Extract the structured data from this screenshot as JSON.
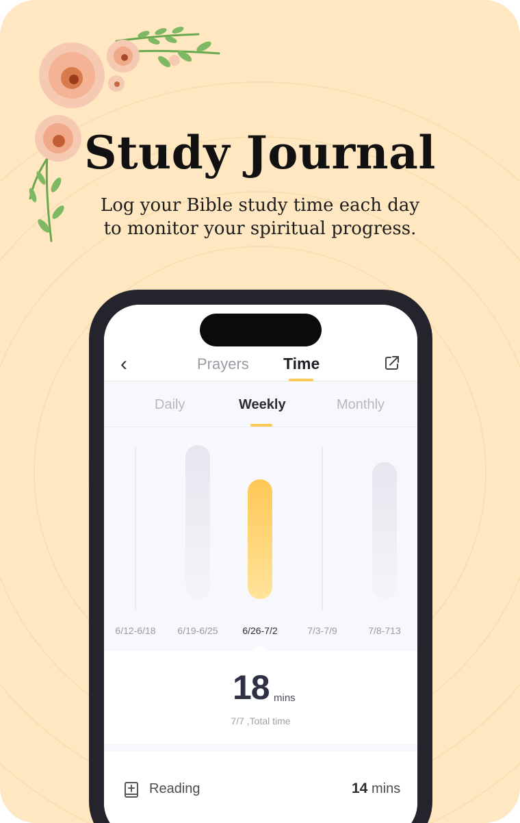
{
  "headline": "Study Journal",
  "subline": [
    "Log your Bible study time each day",
    "to monitor your spiritual progress."
  ],
  "app": {
    "tabs": [
      "Prayers",
      "Time"
    ],
    "active_tab": "Time",
    "subtabs": [
      "Daily",
      "Weekly",
      "Monthly"
    ],
    "active_subtab": "Weekly",
    "icons": {
      "back": "chevron-left-icon",
      "share": "share-icon",
      "reading": "book-icon"
    }
  },
  "chart_data": {
    "type": "bar",
    "categories": [
      "6/12-6/18",
      "6/19-6/25",
      "6/26-7/2",
      "7/3-7/9",
      "7/8-713"
    ],
    "values": [
      0,
      18,
      14,
      0,
      16
    ],
    "selected": "6/26-7/2",
    "colors": {
      "selected": "#ffc856",
      "other": "#e8e8f0"
    }
  },
  "summary": {
    "value": "18",
    "unit": "mins",
    "caption": "7/7 ,Total time"
  },
  "rows": [
    {
      "label": "Reading",
      "value": "14",
      "unit": "mins"
    }
  ],
  "colors": {
    "background": "#ffe7c1",
    "accent": "#ffc856",
    "phone": "#25232b"
  }
}
